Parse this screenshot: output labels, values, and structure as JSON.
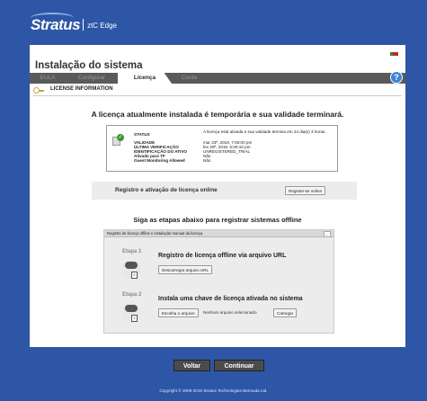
{
  "brand": {
    "name": "Stratus",
    "product": "ztC Edge"
  },
  "page": {
    "title": "Instalação do sistema"
  },
  "tabs": [
    {
      "label": "EULA",
      "state": "done"
    },
    {
      "label": "Configurar",
      "state": "done"
    },
    {
      "label": "Licença",
      "state": "active"
    },
    {
      "label": "Conta",
      "state": "pending"
    }
  ],
  "help_label": "?",
  "section_title": "LICENSE INFORMATION",
  "license_headline": "A licença atualmente instalada é temporária e sua validade terminará.",
  "status": {
    "rows": [
      {
        "label": "STATUS",
        "value": "A licença está ativada e sua validade termina em 24 dia(s) 3 horas."
      },
      {
        "label": "VALIDADE",
        "value": "mar 23ª, 2019, 7:00:00 pm"
      },
      {
        "label": "ÚLTIMA VERIFICAÇÃO",
        "value": "fev 26ª, 2019, 6:00:10 pm"
      },
      {
        "label": "IDENTIFICAÇÃO DO ATIVO",
        "value": "UNREGISTERED_TRIAL"
      },
      {
        "label": "Ativado para TF",
        "value": "Não"
      },
      {
        "label": "Guest Monitoring Allowed",
        "value": "Não"
      }
    ]
  },
  "online": {
    "label": "Registro e ativação de licença online",
    "button": "Registre-se online"
  },
  "offline": {
    "title": "Siga as etapas abaixo para registrar sistemas offline",
    "panel_header": "Registro de licença offline e instalação manual da licença",
    "collapse_label": "–",
    "step1": {
      "label": "Etapa 1",
      "title": "Registro de licença offline via arquivo URL",
      "button": "Descarregar arquivo URL"
    },
    "step2": {
      "label": "Etapa 2",
      "title": "Instala uma chave de licença ativada no sistema",
      "choose_button": "Escolha o arquivo",
      "no_file": "Nenhum arquivo selecionado",
      "upload_button": "Carregar"
    }
  },
  "nav": {
    "back": "Voltar",
    "next": "Continuar"
  },
  "footer": "Copyright © 2009-2019 Stratus Technologies Bermuda Ltd."
}
